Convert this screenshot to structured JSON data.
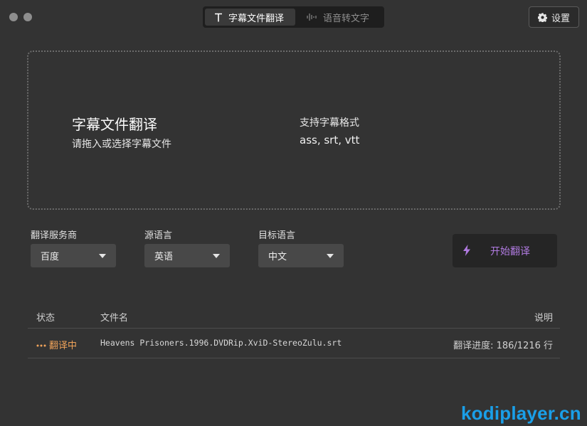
{
  "window": {
    "tabs": [
      {
        "label": "字幕文件翻译",
        "icon": "text-t-icon",
        "active": true
      },
      {
        "label": "语音转文字",
        "icon": "waveform-icon",
        "active": false
      }
    ],
    "settings_label": "设置"
  },
  "dropzone": {
    "title": "字幕文件翻译",
    "subtitle": "请拖入或选择字幕文件",
    "formats_title": "支持字幕格式",
    "formats": "ass, srt, vtt"
  },
  "options": {
    "service": {
      "label": "翻译服务商",
      "value": "百度"
    },
    "source": {
      "label": "源语言",
      "value": "英语"
    },
    "target": {
      "label": "目标语言",
      "value": "中文"
    }
  },
  "start_button": {
    "label": "开始翻译",
    "icon": "lightning-icon",
    "color": "#b07ae0"
  },
  "table": {
    "headers": {
      "status": "状态",
      "filename": "文件名",
      "note": "说明"
    },
    "rows": [
      {
        "status": "翻译中",
        "status_icon": "ellipsis-icon",
        "status_color": "#f0a35a",
        "filename": "Heavens Prisoners.1996.DVDRip.XviD-StereoZulu.srt",
        "note": "翻译进度: 186/1216 行"
      }
    ]
  },
  "watermark": "kodiplayer.cn"
}
